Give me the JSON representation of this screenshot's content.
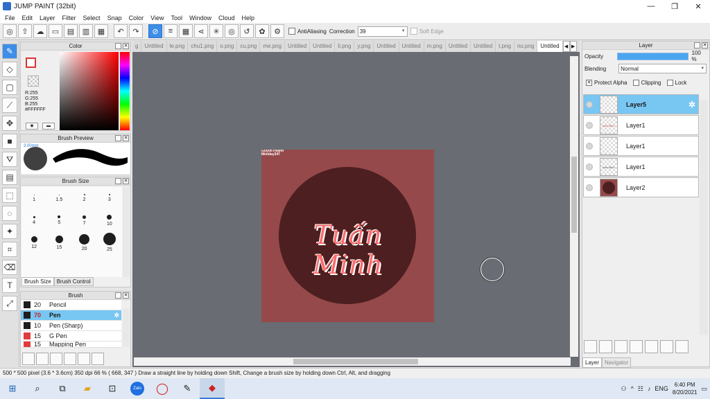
{
  "window": {
    "title": "JUMP PAINT (32bit)",
    "minimize": "—",
    "maximize": "❐",
    "close": "✕"
  },
  "menu": [
    "File",
    "Edit",
    "Layer",
    "Filter",
    "Select",
    "Snap",
    "Color",
    "View",
    "Tool",
    "Window",
    "Cloud",
    "Help"
  ],
  "toolbar": {
    "antialiasing_label": "AntiAliasing",
    "correction_label": "Correction",
    "correction_value": "39",
    "softedge_label": "Soft Edge"
  },
  "color_panel": {
    "title": "Color",
    "rgb": [
      "R:255",
      "G:255",
      "B:255",
      "#FFFFFF"
    ],
    "accent": "#ff0000"
  },
  "brush_preview": {
    "title": "Brush Preview",
    "size_label": "3.00mm"
  },
  "brush_size": {
    "title": "Brush Size",
    "sizes": [
      "1",
      "1.5",
      "2",
      "3",
      "4",
      "5",
      "7",
      "10",
      "12",
      "15",
      "20",
      "25"
    ],
    "tabs": [
      "Brush Size",
      "Brush Control"
    ]
  },
  "brush_list": {
    "title": "Brush",
    "items": [
      {
        "size": "20",
        "name": "Pencil",
        "color": "#1e1e1e"
      },
      {
        "size": "70",
        "name": "Pen",
        "color": "#1e1e1e"
      },
      {
        "size": "10",
        "name": "Pen (Sharp)",
        "color": "#1e1e1e"
      },
      {
        "size": "15",
        "name": "G Pen",
        "color": "#e03c3c"
      },
      {
        "size": "15",
        "name": "Mapping Pen",
        "color": "#e03c3c"
      }
    ]
  },
  "file_tabs": [
    "g",
    "Untitled",
    "le.png",
    "chu1.png",
    "o.png",
    "cu.png",
    "me.png",
    "Untitled",
    "Untitled",
    "li.png",
    "y.png",
    "Untitled",
    "Untitled",
    "m.png",
    "Untitled",
    "Untitled",
    "t.png",
    "nu.png",
    "Untitled"
  ],
  "artwork": {
    "watermark_line1": "GuyuhThiann",
    "watermark_line2": "Miolday247",
    "name": "Tuấn Minh",
    "bg_color": "#96494a",
    "circle_color": "#4d1f20"
  },
  "layer_panel": {
    "title": "Layer",
    "opacity_label": "Opacity",
    "opacity_value": "100 %",
    "blending_label": "Blending",
    "blending_value": "Normal",
    "protect_alpha": "Protect Alpha",
    "clipping": "Clipping",
    "lock": "Lock",
    "layers": [
      "Layer5",
      "Layer1",
      "Layer1",
      "Layer1",
      "Layer2"
    ],
    "thumb_text": "tuấn Minh",
    "tabs": [
      "Layer",
      "Navigator"
    ]
  },
  "status": {
    "dimensions": "500 * 500 pixel",
    "physical": "(3.6 * 3.6cm)",
    "dpi": "350 dpi",
    "zoom": "66 %",
    "coords": "( 668, 347 )",
    "hint": "Draw a straight line by holding down Shift, Change a brush size by holding down Ctrl, Alt, and dragging"
  },
  "taskbar": {
    "lang": "ENG",
    "time": "6:40 PM",
    "date": "8/20/2021",
    "zalo": "Zalo"
  }
}
